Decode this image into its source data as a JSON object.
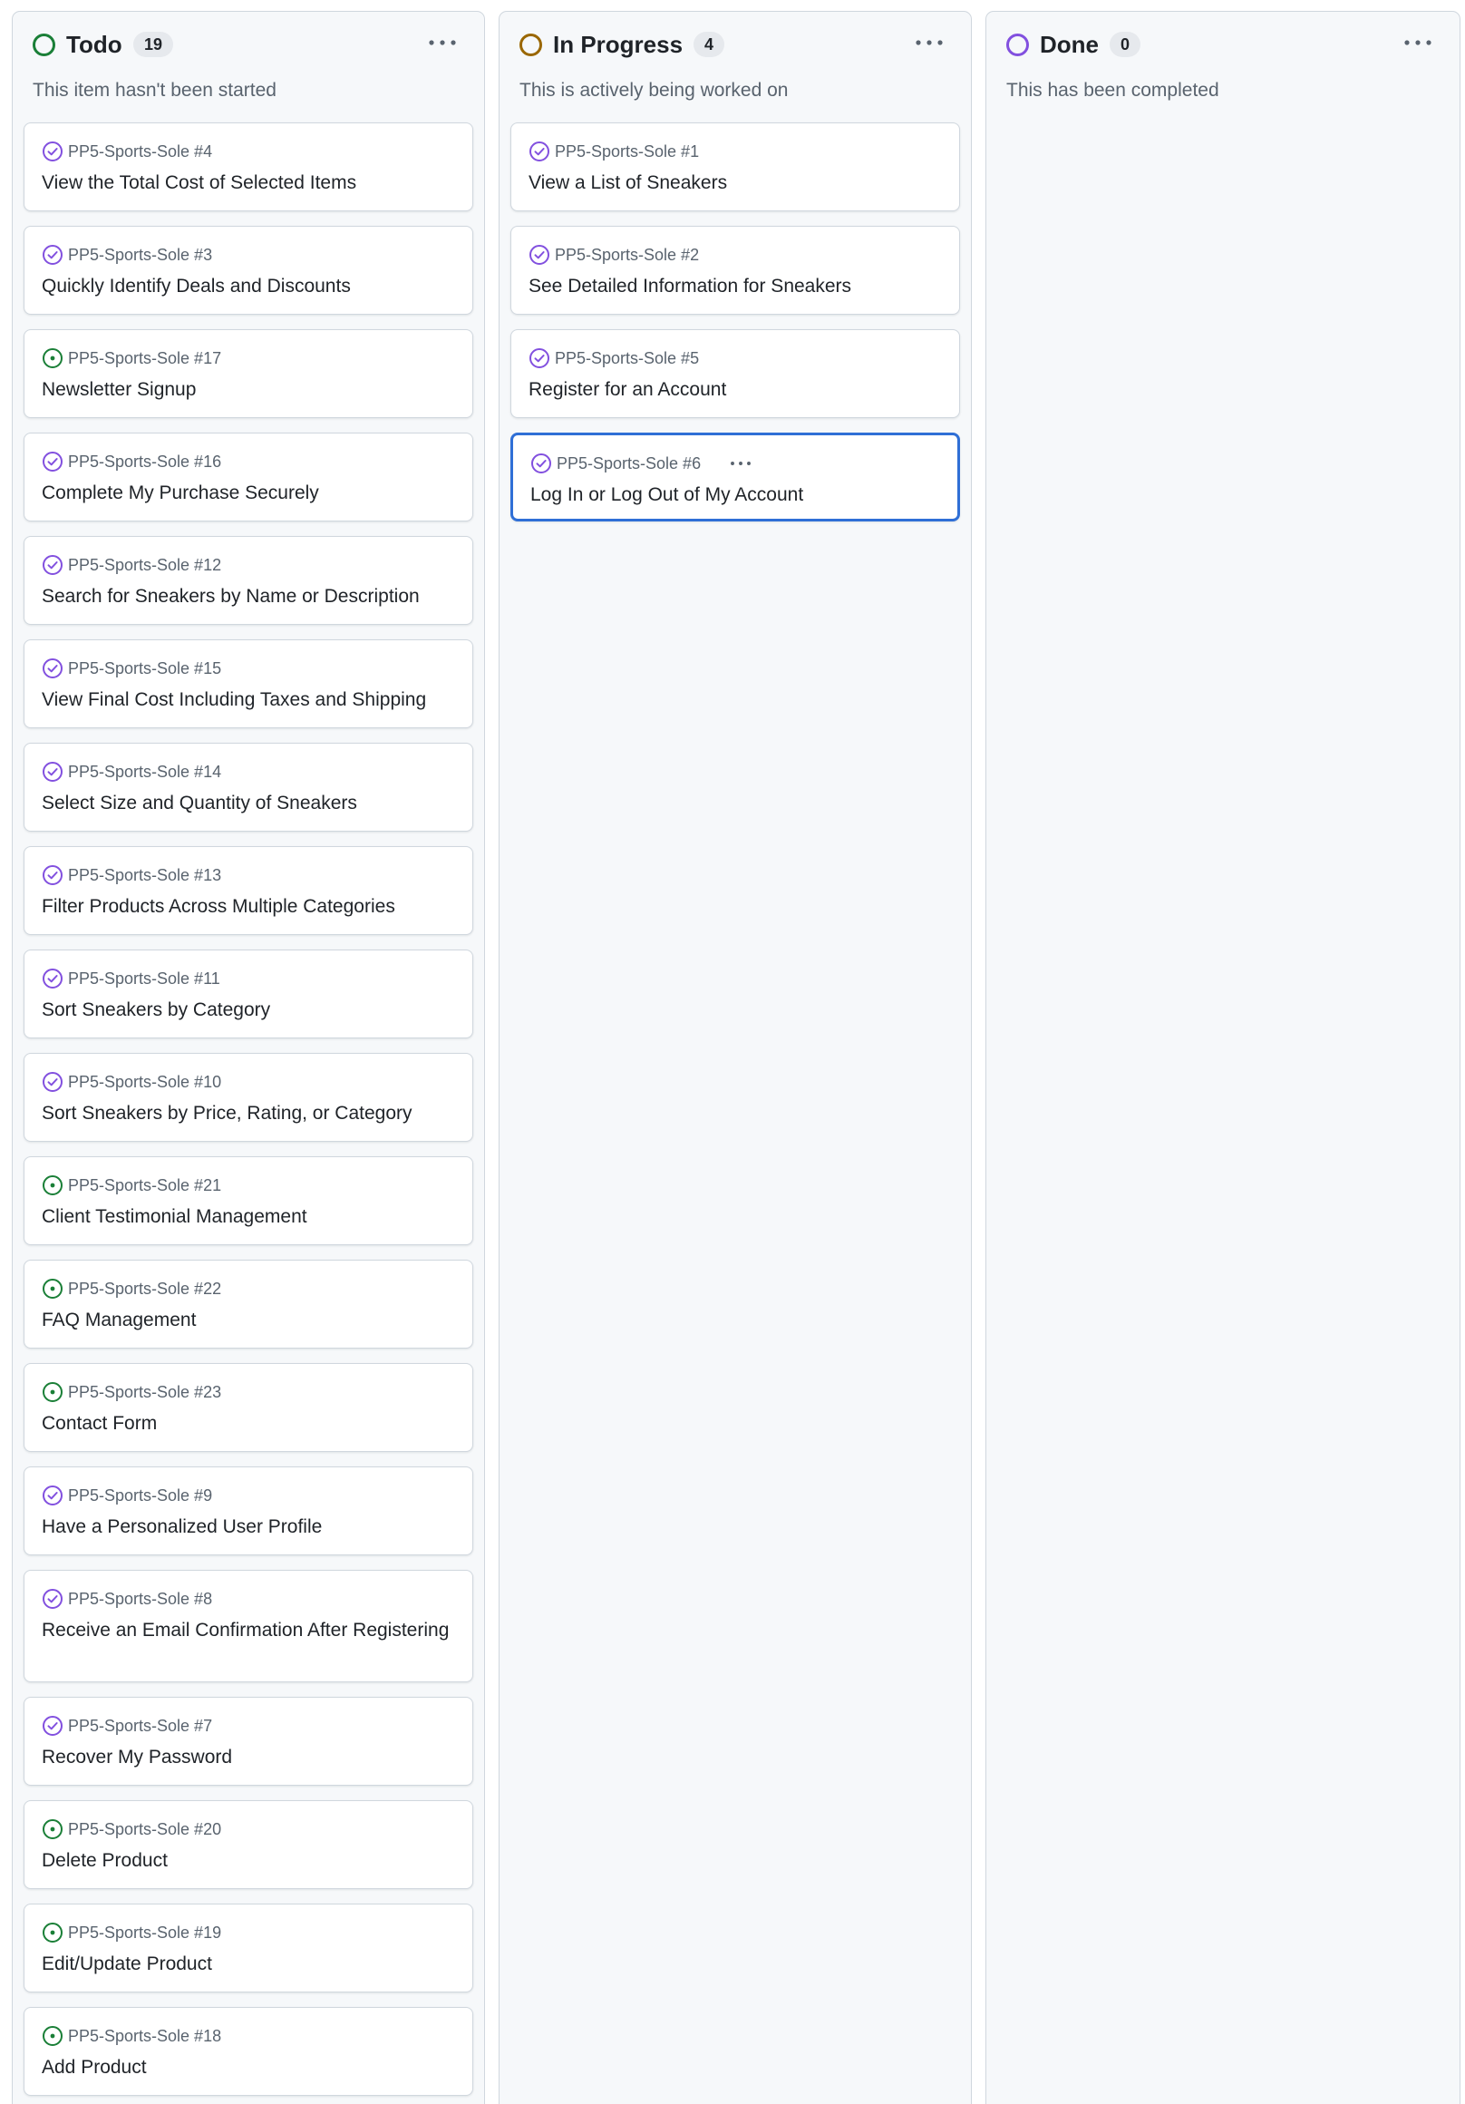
{
  "colors": {
    "todo_status": "#1a7f37",
    "in_progress_status": "#9a6700",
    "done_status": "#8250df",
    "issue_closed_purple": "#8250df",
    "issue_open_green": "#1a7f37",
    "focus_blue": "#2f6fd6"
  },
  "columns": [
    {
      "title": "Todo",
      "count": "19",
      "description": "This item hasn't been started",
      "status_icon": "circle-green-icon",
      "menu_icon": "kebab-horizontal-icon",
      "cards": [
        {
          "ref": "PP5-Sports-Sole #4",
          "title": "View the Total Cost of Selected Items",
          "icon": "issue-closed-icon"
        },
        {
          "ref": "PP5-Sports-Sole #3",
          "title": "Quickly Identify Deals and Discounts",
          "icon": "issue-closed-icon"
        },
        {
          "ref": "PP5-Sports-Sole #17",
          "title": "Newsletter Signup",
          "icon": "issue-opened-icon"
        },
        {
          "ref": "PP5-Sports-Sole #16",
          "title": "Complete My Purchase Securely",
          "icon": "issue-closed-icon"
        },
        {
          "ref": "PP5-Sports-Sole #12",
          "title": "Search for Sneakers by Name or Description",
          "icon": "issue-closed-icon"
        },
        {
          "ref": "PP5-Sports-Sole #15",
          "title": "View Final Cost Including Taxes and Shipping",
          "icon": "issue-closed-icon"
        },
        {
          "ref": "PP5-Sports-Sole #14",
          "title": "Select Size and Quantity of Sneakers",
          "icon": "issue-closed-icon"
        },
        {
          "ref": "PP5-Sports-Sole #13",
          "title": "Filter Products Across Multiple Categories",
          "icon": "issue-closed-icon"
        },
        {
          "ref": "PP5-Sports-Sole #11",
          "title": "Sort Sneakers by Category",
          "icon": "issue-closed-icon"
        },
        {
          "ref": "PP5-Sports-Sole #10",
          "title": "Sort Sneakers by Price, Rating, or Category",
          "icon": "issue-closed-icon"
        },
        {
          "ref": "PP5-Sports-Sole #21",
          "title": "Client Testimonial Management",
          "icon": "issue-opened-icon"
        },
        {
          "ref": "PP5-Sports-Sole #22",
          "title": "FAQ Management",
          "icon": "issue-opened-icon"
        },
        {
          "ref": "PP5-Sports-Sole #23",
          "title": "Contact Form",
          "icon": "issue-opened-icon"
        },
        {
          "ref": "PP5-Sports-Sole #9",
          "title": "Have a Personalized User Profile",
          "icon": "issue-closed-icon"
        },
        {
          "ref": "PP5-Sports-Sole #8",
          "title": "Receive an Email Confirmation After Registering",
          "icon": "issue-closed-icon"
        },
        {
          "ref": "PP5-Sports-Sole #7",
          "title": "Recover My Password",
          "icon": "issue-closed-icon"
        },
        {
          "ref": "PP5-Sports-Sole #20",
          "title": "Delete Product",
          "icon": "issue-opened-icon"
        },
        {
          "ref": "PP5-Sports-Sole #19",
          "title": "Edit/Update Product",
          "icon": "issue-opened-icon"
        },
        {
          "ref": "PP5-Sports-Sole #18",
          "title": "Add Product",
          "icon": "issue-opened-icon"
        }
      ]
    },
    {
      "title": "In Progress",
      "count": "4",
      "description": "This is actively being worked on",
      "status_icon": "circle-yellow-icon",
      "menu_icon": "kebab-horizontal-icon",
      "cards": [
        {
          "ref": "PP5-Sports-Sole #1",
          "title": "View a List of Sneakers",
          "icon": "issue-closed-icon"
        },
        {
          "ref": "PP5-Sports-Sole #2",
          "title": "See Detailed Information for Sneakers",
          "icon": "issue-closed-icon"
        },
        {
          "ref": "PP5-Sports-Sole #5",
          "title": "Register for an Account",
          "icon": "issue-closed-icon"
        },
        {
          "ref": "PP5-Sports-Sole #6",
          "title": "Log In or Log Out of My Account",
          "icon": "issue-closed-icon",
          "focused": true,
          "menu_icon": "kebab-horizontal-icon"
        }
      ]
    },
    {
      "title": "Done",
      "count": "0",
      "description": "This has been completed",
      "status_icon": "circle-purple-icon",
      "menu_icon": "kebab-horizontal-icon",
      "cards": []
    }
  ]
}
